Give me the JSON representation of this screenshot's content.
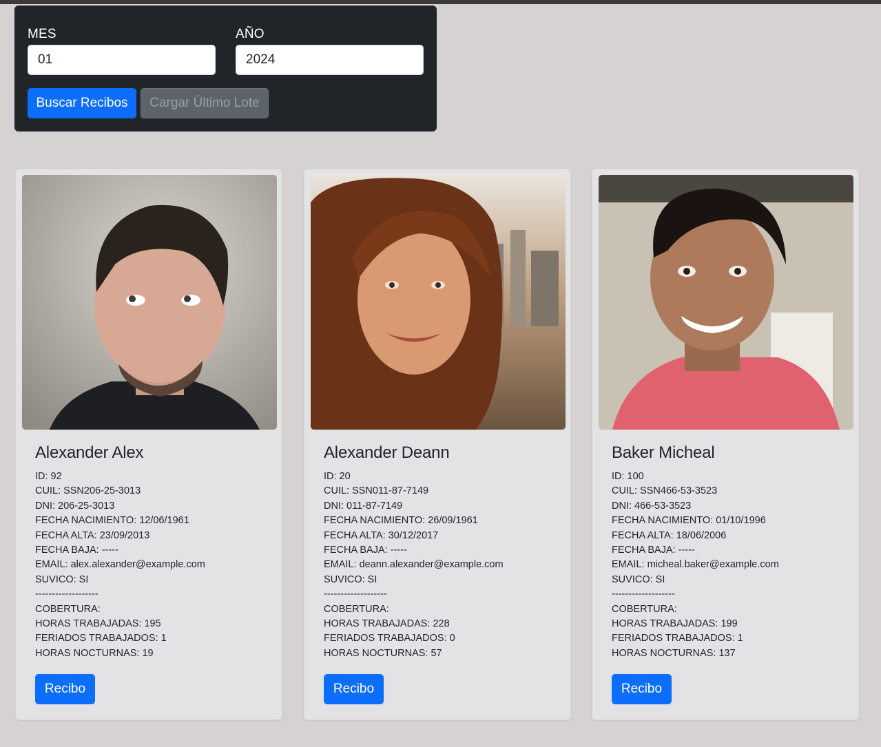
{
  "filters": {
    "month_label": "MES",
    "month_value": "01",
    "year_label": "AÑO",
    "year_value": "2024",
    "search_button": "Buscar Recibos",
    "load_last_button": "Cargar Último Lote"
  },
  "colors": {
    "page_bg": "#d6d2d1",
    "panel_bg": "#212529",
    "primary": "#0d6efd",
    "secondary": "#5c636a",
    "card_bg": "#e3e3e5"
  },
  "employees": [
    {
      "name": "Alexander Alex",
      "photo_icon": "employee-photo",
      "lines": [
        "ID: 92",
        "CUIL: SSN206-25-3013",
        "DNI: 206-25-3013",
        "FECHA NACIMIENTO: 12/06/1961",
        "FECHA ALTA: 23/09/2013",
        "FECHA BAJA: -----",
        "EMAIL: alex.alexander@example.com",
        "SUVICO: SI",
        "-------------------",
        "COBERTURA:",
        "HORAS TRABAJADAS: 195",
        "FERIADOS TRABAJADOS: 1",
        "HORAS NOCTURNAS: 19"
      ],
      "button": "Recibo"
    },
    {
      "name": "Alexander Deann",
      "photo_icon": "employee-photo",
      "lines": [
        "ID: 20",
        "CUIL: SSN011-87-7149",
        "DNI: 011-87-7149",
        "FECHA NACIMIENTO: 26/09/1961",
        "FECHA ALTA: 30/12/2017",
        "FECHA BAJA: -----",
        "EMAIL: deann.alexander@example.com",
        "SUVICO: SI",
        "-------------------",
        "COBERTURA:",
        "HORAS TRABAJADAS: 228",
        "FERIADOS TRABAJADOS: 0",
        "HORAS NOCTURNAS: 57"
      ],
      "button": "Recibo"
    },
    {
      "name": "Baker Micheal",
      "photo_icon": "employee-photo",
      "lines": [
        "ID: 100",
        "CUIL: SSN466-53-3523",
        "DNI: 466-53-3523",
        "FECHA NACIMIENTO: 01/10/1996",
        "FECHA ALTA: 18/06/2006",
        "FECHA BAJA: -----",
        "EMAIL: micheal.baker@example.com",
        "SUVICO: SI",
        "-------------------",
        "COBERTURA:",
        "HORAS TRABAJADAS: 199",
        "FERIADOS TRABAJADOS: 1",
        "HORAS NOCTURNAS: 137"
      ],
      "button": "Recibo"
    }
  ]
}
